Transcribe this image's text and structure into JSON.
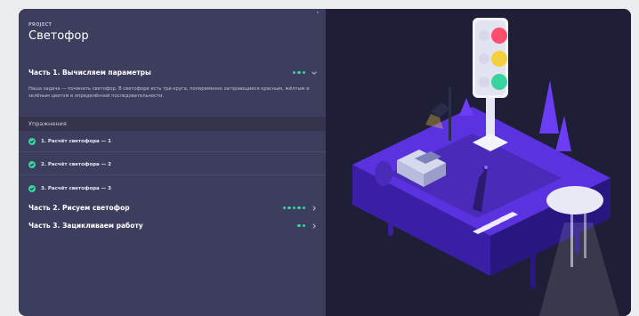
{
  "project": {
    "label": "PROJECT",
    "title": "Светофор"
  },
  "part1": {
    "title": "Часть 1. Вычисляем параметры",
    "progress_dots": 3,
    "expanded": true,
    "description": "Наша задача — починить светофор. В светофоре есть три круга, попеременно загорающиеся красным, жёлтым и зелёным цветом в определённой последовательности."
  },
  "exercises": {
    "header": "Упражнения",
    "items": [
      {
        "label": "1. Расчёт светофора — 1",
        "done": true
      },
      {
        "label": "2. Расчёт светофора — 2",
        "done": true
      },
      {
        "label": "3. Расчёт светофора — 3",
        "done": true
      }
    ]
  },
  "part2": {
    "title": "Часть 2. Рисуем светофор",
    "progress_dots": 5
  },
  "part3": {
    "title": "Часть 3. Зацикливаем работу",
    "progress_dots": 2
  },
  "illustration": {
    "icon": "traffic-light-isometric-scene-illustration",
    "light_colors": [
      "#ff4d6d",
      "#f4d03f",
      "#3ad29f"
    ]
  },
  "colors": {
    "accent_green": "#3ad29f",
    "panel": "#3d3d5e",
    "scene_bg": "#1e1e36",
    "purple": "#6b3df5"
  }
}
